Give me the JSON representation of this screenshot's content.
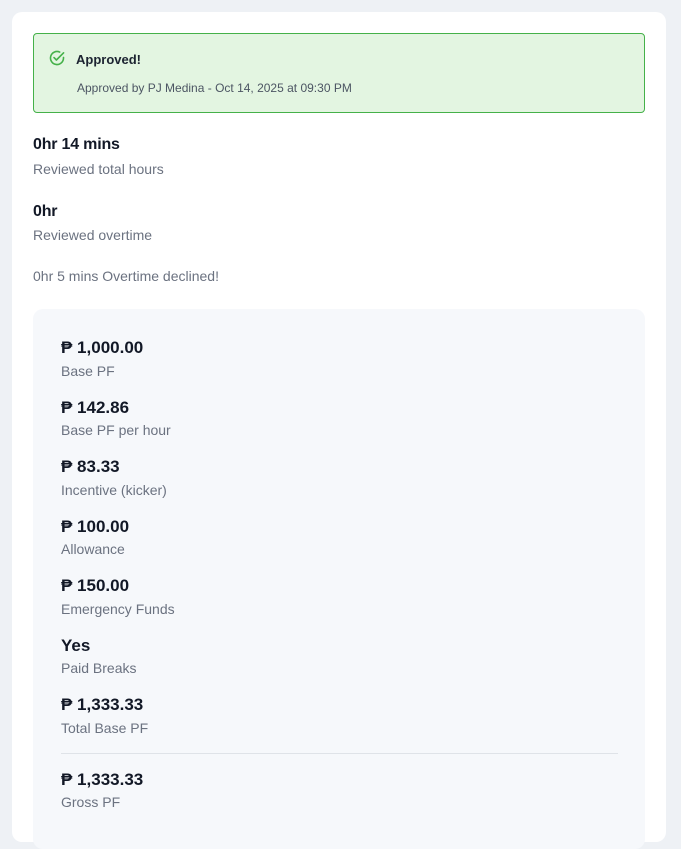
{
  "banner": {
    "title": "Approved!",
    "subtitle": "Approved by PJ Medina - Oct 14, 2025 at 09:30 PM",
    "accent_color": "#45b149",
    "icon": "check-circle-icon"
  },
  "reviewed": {
    "total_hours_value": "0hr 14 mins",
    "total_hours_label": "Reviewed total hours",
    "overtime_value": "0hr",
    "overtime_label": "Reviewed overtime"
  },
  "overtime_declined": "0hr 5 mins Overtime declined!",
  "pf_items": [
    {
      "value": "₱ 1,000.00",
      "label": "Base PF"
    },
    {
      "value": "₱ 142.86",
      "label": "Base PF per hour"
    },
    {
      "value": "₱ 83.33",
      "label": "Incentive (kicker)"
    },
    {
      "value": "₱ 100.00",
      "label": "Allowance"
    },
    {
      "value": "₱ 150.00",
      "label": "Emergency Funds"
    },
    {
      "value": "Yes",
      "label": "Paid Breaks"
    },
    {
      "value": "₱ 1,333.33",
      "label": "Total Base PF"
    }
  ],
  "gross": {
    "value": "₱ 1,333.33",
    "label": "Gross PF"
  }
}
